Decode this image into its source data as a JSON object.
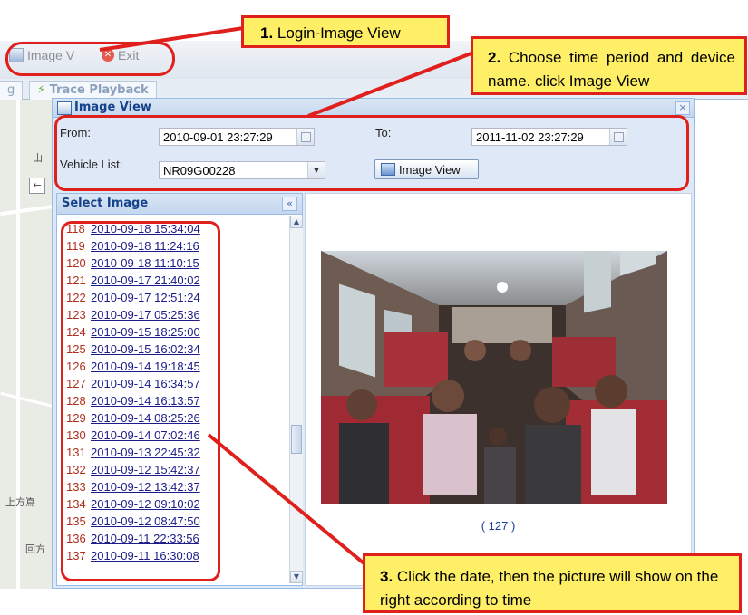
{
  "toolbar": {
    "image_view_label": "Image V",
    "exit_label": "Exit"
  },
  "tabs": {
    "partial_tab_label": "g",
    "trace_playback_label": "Trace Playback"
  },
  "map": {
    "label_1": "山",
    "label_2": "上方嶌",
    "label_3": "回方",
    "back_arrow": "←"
  },
  "dialog": {
    "title": "Image View",
    "close_glyph": "×",
    "from_label": "From:",
    "from_value": "2010-09-01 23:27:29",
    "to_label": "To:",
    "to_value": "2011-11-02 23:27:29",
    "vehicle_label": "Vehicle List:",
    "vehicle_value": "NR09G00228",
    "image_view_button": "Image View"
  },
  "select_image": {
    "title": "Select Image",
    "collapse_glyph": "«",
    "items": [
      {
        "idx": "118",
        "date": "2010-09-18 15:34:04"
      },
      {
        "idx": "119",
        "date": "2010-09-18 11:24:16"
      },
      {
        "idx": "120",
        "date": "2010-09-18 11:10:15"
      },
      {
        "idx": "121",
        "date": "2010-09-17 21:40:02"
      },
      {
        "idx": "122",
        "date": "2010-09-17 12:51:24"
      },
      {
        "idx": "123",
        "date": "2010-09-17 05:25:36"
      },
      {
        "idx": "124",
        "date": "2010-09-15 18:25:00"
      },
      {
        "idx": "125",
        "date": "2010-09-15 16:02:34"
      },
      {
        "idx": "126",
        "date": "2010-09-14 19:18:45"
      },
      {
        "idx": "127",
        "date": "2010-09-14 16:34:57"
      },
      {
        "idx": "128",
        "date": "2010-09-14 16:13:57"
      },
      {
        "idx": "129",
        "date": "2010-09-14 08:25:26"
      },
      {
        "idx": "130",
        "date": "2010-09-14 07:02:46"
      },
      {
        "idx": "131",
        "date": "2010-09-13 22:45:32"
      },
      {
        "idx": "132",
        "date": "2010-09-12 15:42:37"
      },
      {
        "idx": "133",
        "date": "2010-09-12 13:42:37"
      },
      {
        "idx": "134",
        "date": "2010-09-12 09:10:02"
      },
      {
        "idx": "135",
        "date": "2010-09-12 08:47:50"
      },
      {
        "idx": "136",
        "date": "2010-09-11 22:33:56"
      },
      {
        "idx": "137",
        "date": "2010-09-11 16:30:08"
      }
    ]
  },
  "preview": {
    "caption": "( 127 )"
  },
  "callouts": {
    "c1_num": "1.",
    "c1_text": " Login-Image View",
    "c2_num": "2.",
    "c2_text": " Choose time period and device name. click Image View",
    "c3_num": "3.",
    "c3_text": " Click the date, then the picture will show on the right according to time"
  },
  "colors": {
    "accent_red": "#e0201c",
    "callout_yellow": "#ffef66",
    "panel_title_blue": "#15428b"
  }
}
